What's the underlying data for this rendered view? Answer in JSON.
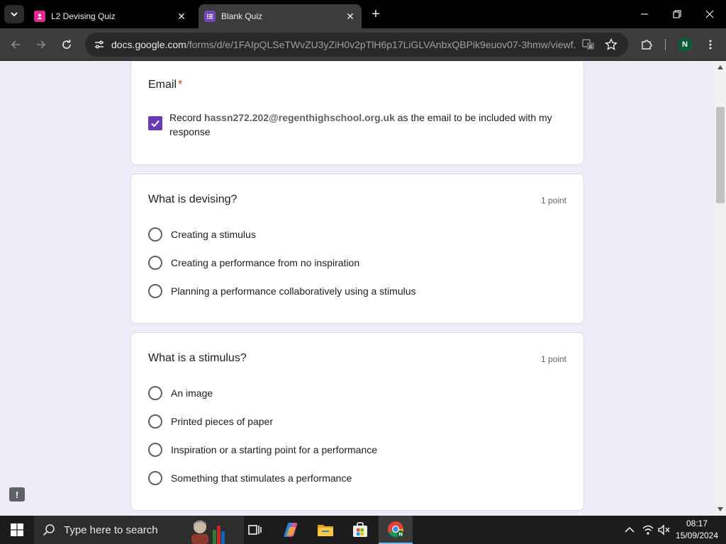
{
  "browser": {
    "tabs": [
      {
        "title": "L2 Devising Quiz",
        "favicon": "contacts-form-icon",
        "color": "#e52592"
      },
      {
        "title": "Blank Quiz",
        "favicon": "forms-icon",
        "color": "#7248b9"
      }
    ],
    "close_symbol": "✕",
    "new_tab_symbol": "+",
    "url_host": "docs.google.com",
    "url_path": "/forms/d/e/1FAIpQLSeTWvZU3yZiH0v2pTlH6p17LiGLVAnbxQBPik9euov07-3hmw/viewf...",
    "profile_initial": "N"
  },
  "form": {
    "accent_color": "#673ab7",
    "email_section": {
      "title": "Email",
      "required_mark": "*",
      "checkbox_checked": true,
      "record_prefix": "Record",
      "email": "hassn272.202@regenthighschool.org.uk",
      "record_suffix": "as the email to be included with my response"
    },
    "questions": [
      {
        "title": "What is devising?",
        "points": "1 point",
        "options": [
          "Creating a stimulus",
          "Creating a performance from no inspiration",
          "Planning a performance collaboratively using a stimulus"
        ]
      },
      {
        "title": "What is a stimulus?",
        "points": "1 point",
        "options": [
          "An image",
          "Printed pieces of paper",
          "Inspiration or a starting point for a performance",
          "Something that stimulates a performance"
        ]
      }
    ],
    "feedback_symbol": "!"
  },
  "taskbar": {
    "search_placeholder": "Type here to search",
    "apps": [
      "task-view-icon",
      "copilot-icon",
      "file-explorer-icon",
      "microsoft-store-icon",
      "chrome-icon"
    ],
    "time": "08:17",
    "date": "15/09/2024"
  }
}
